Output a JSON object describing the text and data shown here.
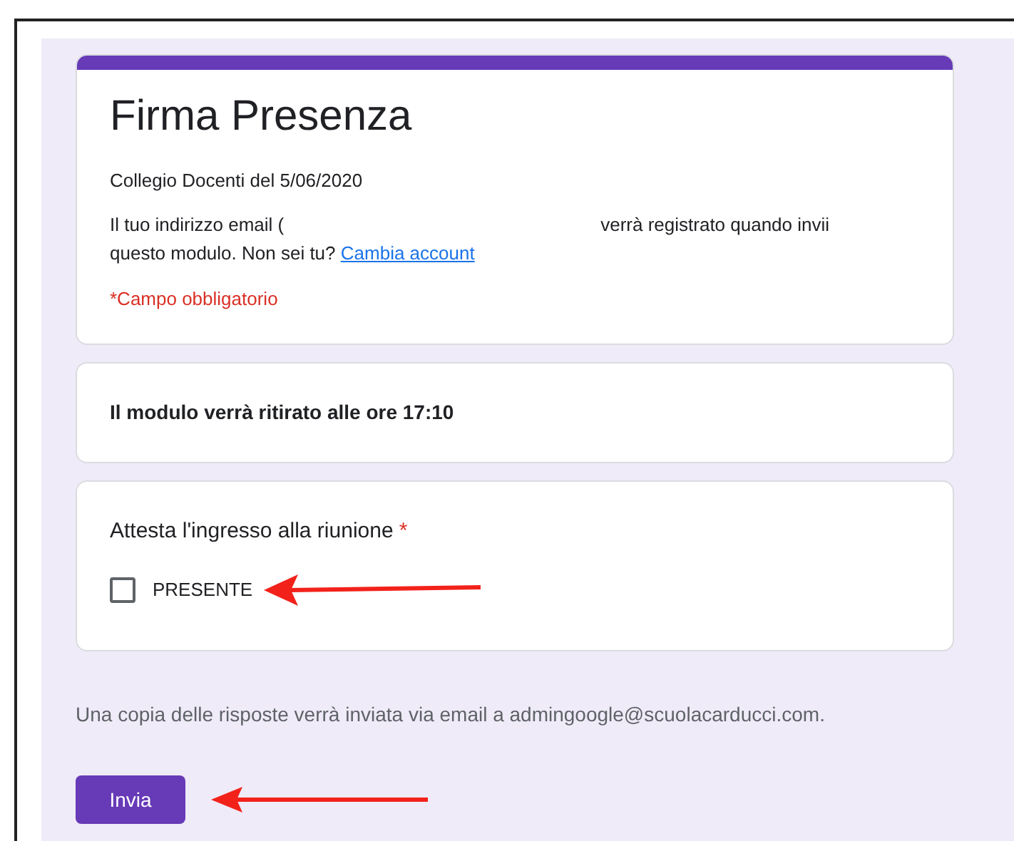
{
  "form": {
    "title": "Firma Presenza",
    "description": "Collegio Docenti del 5/06/2020",
    "email_notice": {
      "before": "Il tuo indirizzo email (",
      "after": "verrà registrato quando invii questo modulo. Non sei tu?",
      "link": "Cambia account"
    },
    "required_note": "*Campo obbligatorio"
  },
  "notice_card": {
    "text": "Il modulo verrà ritirato alle ore 17:10"
  },
  "question": {
    "label": "Attesta l'ingresso alla riunione",
    "required_mark": "*",
    "options": [
      {
        "label": "PRESENTE",
        "checked": false
      }
    ]
  },
  "footer_note": "Una copia delle risposte verrà inviata via email a admingoogle@scuolacarducci.com.",
  "submit_button": "Invia"
}
